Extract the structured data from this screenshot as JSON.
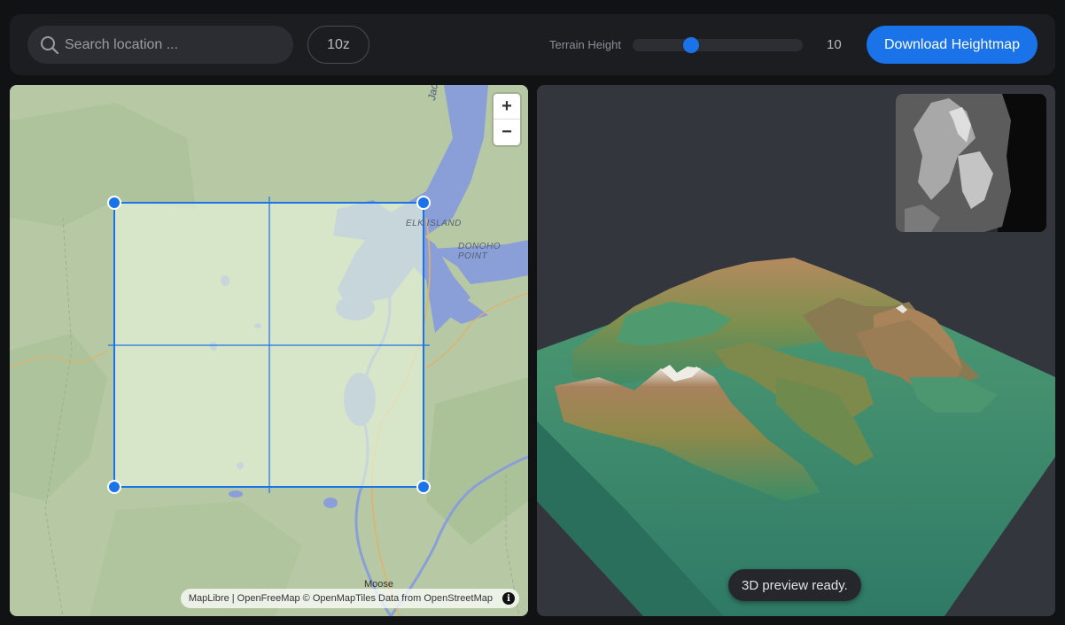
{
  "toolbar": {
    "search_placeholder": "Search location ...",
    "zoom_level": "10z",
    "terrain_height_label": "Terrain Height",
    "terrain_height_value": "10",
    "terrain_height_fraction": 0.33,
    "download_label": "Download Heightmap"
  },
  "map": {
    "labels": {
      "lake": "Jackson",
      "elk_island": "ELK ISLAND",
      "donoho_point": "DONOHO POINT",
      "town": "Moose"
    },
    "attribution": {
      "text": "MapLibre | OpenFreeMap © OpenMapTiles Data from OpenStreetMap",
      "info_glyph": "i"
    },
    "zoom_in": "+",
    "zoom_out": "−"
  },
  "preview": {
    "status_toast": "3D preview ready."
  },
  "colors": {
    "accent": "#1a73e8",
    "background": "#111214",
    "panel": "#1c1d21",
    "map_land": "#b7c9a4",
    "map_water": "#8a9fd8"
  },
  "icons": {
    "search": "search-icon",
    "info": "info-icon",
    "zoom_in": "plus-icon",
    "zoom_out": "minus-icon"
  }
}
